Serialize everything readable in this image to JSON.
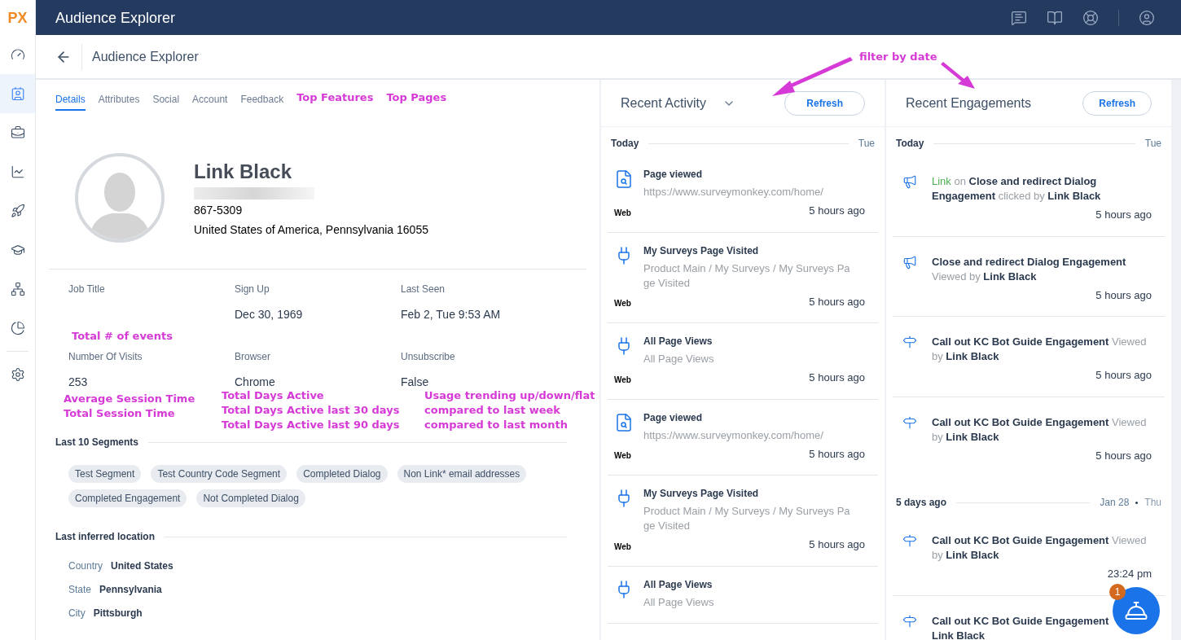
{
  "app": {
    "logo": "PX",
    "title": "Audience Explorer"
  },
  "sidebar": {
    "items": [
      {
        "kind": "gauge",
        "selected": false
      },
      {
        "kind": "contact",
        "selected": true
      },
      {
        "kind": "briefcase",
        "selected": false
      },
      {
        "kind": "chart",
        "selected": false
      },
      {
        "kind": "rocket",
        "selected": false
      },
      {
        "kind": "cap",
        "selected": false
      },
      {
        "kind": "tree",
        "selected": false
      },
      {
        "kind": "pie",
        "selected": false
      },
      {
        "kind": "settings",
        "selected": false
      }
    ]
  },
  "header": {
    "title": "Audience Explorer"
  },
  "tabs": [
    {
      "label": "Details",
      "selected": true
    },
    {
      "label": "Attributes",
      "selected": false
    },
    {
      "label": "Social",
      "selected": false
    },
    {
      "label": "Account",
      "selected": false
    },
    {
      "label": "Feedback",
      "selected": false
    }
  ],
  "tab_annotations": [
    "Top Features",
    "Top Pages"
  ],
  "profile": {
    "name": "Link Black",
    "phone": "867-5309",
    "location": "United States of America, Pennsylvania 16055"
  },
  "fields": [
    [
      {
        "label": "Job Title"
      },
      {
        "label": "Sign Up",
        "value": "Dec 30, 1969"
      },
      {
        "label": "Last Seen",
        "value": "Feb 2, Tue 9:53 AM"
      }
    ],
    [
      {
        "label": "Number Of Visits",
        "value": "253"
      },
      {
        "label": "Browser",
        "value": "Chrome"
      },
      {
        "label": "Unsubscribe",
        "value": "False"
      }
    ]
  ],
  "annotations": {
    "events": "Total # of events",
    "notes": [
      [
        "Average Session Time",
        "Total Session Time"
      ],
      [
        "Total Days Active",
        "Total Days Active last 30 days",
        "Total Days Active last 90 days"
      ],
      [
        "Usage trending up/down/flat",
        "compared to last week",
        "compared to last month"
      ]
    ],
    "filter": "filter by date"
  },
  "segments": {
    "title": "Last 10 Segments",
    "tags": [
      "Test Segment",
      "Test Country Code Segment",
      "Completed Dialog",
      "Non Link* email addresses",
      "Completed Engagement",
      "Not Completed Dialog"
    ]
  },
  "location": {
    "title": "Last inferred location",
    "rows": [
      {
        "label": "Country",
        "value": "United States"
      },
      {
        "label": "State",
        "value": "Pennsylvania"
      },
      {
        "label": "City",
        "value": "Pittsburgh"
      }
    ]
  },
  "activity": {
    "title": "Recent Activity",
    "button": "Refresh",
    "groups": [
      {
        "label": "Today",
        "date": "Tue",
        "items": [
          {
            "kind": "page",
            "title": "Page viewed",
            "detail": "https://www.surveymonkey.com/home/",
            "source": "Web",
            "time": "5 hours ago"
          },
          {
            "kind": "feature",
            "title": "My Surveys Page Visited",
            "detail": "Product Main / My Surveys / My Surveys Page Visited",
            "source": "Web",
            "time": "5 hours ago"
          },
          {
            "kind": "feature",
            "title": "All Page Views",
            "detail": "All Page Views",
            "source": "Web",
            "time": "5 hours ago"
          },
          {
            "kind": "page",
            "title": "Page viewed",
            "detail": "https://www.surveymonkey.com/home/",
            "source": "Web",
            "time": "5 hours ago"
          },
          {
            "kind": "feature",
            "title": "My Surveys Page Visited",
            "detail": "Product Main / My Surveys / My Surveys Page Visited",
            "source": "Web",
            "time": "5 hours ago"
          },
          {
            "kind": "feature",
            "title": "All Page Views",
            "detail": "All Page Views"
          }
        ]
      }
    ]
  },
  "engagements": {
    "title": "Recent Engagements",
    "button": "Refresh",
    "groups": [
      {
        "label": "Today",
        "date": "Tue",
        "items": [
          {
            "kind": "announcement",
            "parts": [
              {
                "kind": "accent",
                "text": "Link"
              },
              {
                "kind": "muted",
                "text": " on "
              },
              {
                "kind": "strong",
                "text": "Close and redirect Dialog Engagement"
              },
              {
                "kind": "muted",
                "text": " clicked by "
              },
              {
                "kind": "strong",
                "text": "Link Black"
              }
            ],
            "time": "5 hours ago"
          },
          {
            "kind": "announcement",
            "parts": [
              {
                "kind": "strong",
                "text": "Close and redirect Dialog Engagement"
              },
              {
                "kind": "muted",
                "text": " Viewed by "
              },
              {
                "kind": "strong",
                "text": "Link Black"
              }
            ],
            "time": "5 hours ago"
          },
          {
            "kind": "guide",
            "parts": [
              {
                "kind": "strong",
                "text": "Call out KC Bot Guide Engagement"
              },
              {
                "kind": "muted",
                "text": " Viewed by "
              },
              {
                "kind": "strong",
                "text": "Link Black"
              }
            ],
            "time": "5 hours ago"
          },
          {
            "kind": "guide",
            "parts": [
              {
                "kind": "strong",
                "text": "Call out KC Bot Guide Engagement"
              },
              {
                "kind": "muted",
                "text": " Viewed by "
              },
              {
                "kind": "strong",
                "text": "Link Black"
              }
            ],
            "time": "5 hours ago"
          }
        ]
      },
      {
        "label": "5 days ago",
        "date": "Jan 28",
        "separator": true,
        "day": "Thu",
        "items": [
          {
            "kind": "guide",
            "parts": [
              {
                "kind": "strong",
                "text": "Call out KC Bot Guide Engagement"
              },
              {
                "kind": "muted",
                "text": " Viewed by "
              },
              {
                "kind": "strong",
                "text": "Link Black"
              }
            ],
            "time": "23:24 pm"
          },
          {
            "kind": "guide",
            "parts": [
              {
                "kind": "strong",
                "text": "Call out KC Bot Guide Engagement"
              },
              {
                "kind": "strong",
                "text": "Link Black"
              }
            ]
          }
        ]
      }
    ]
  },
  "help_button": {
    "badge": "1"
  }
}
